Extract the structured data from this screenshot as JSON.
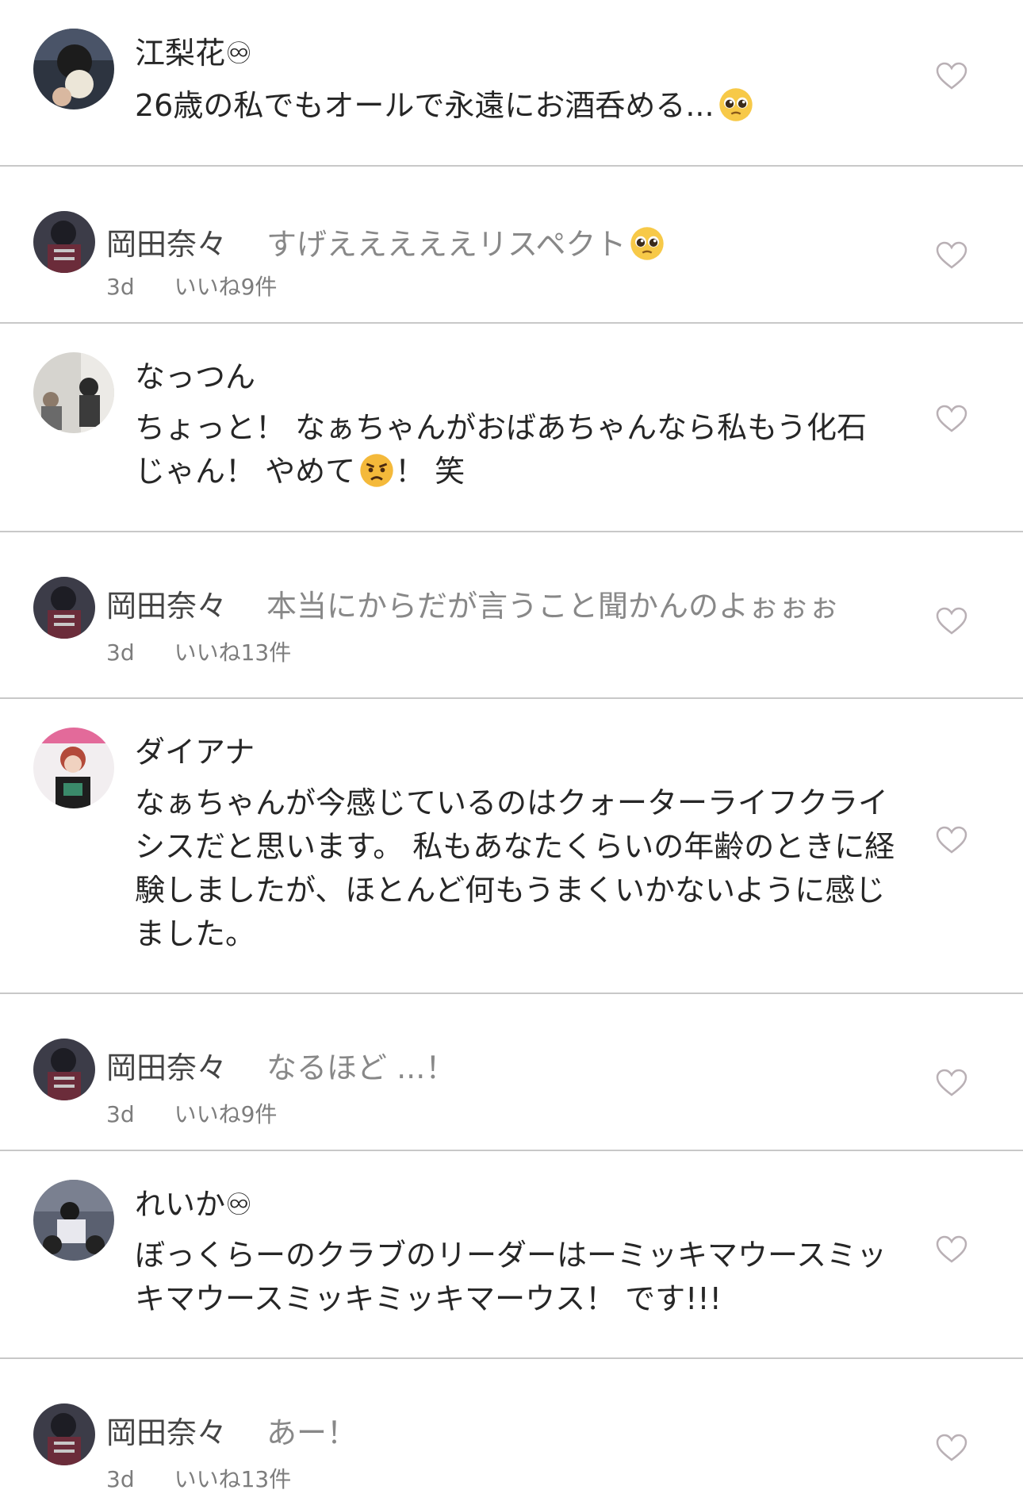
{
  "comments": [
    {
      "type": "comment",
      "author": "江梨花♾",
      "text": "26歳の私でもオールで永遠にお酒呑める...",
      "emoji": "pleading-face-emoji"
    },
    {
      "type": "reply",
      "author": "岡田奈々",
      "text": "すげえええええリスペクト",
      "emoji": "pleading-face-emoji",
      "time": "3d",
      "likes": "いいね9件"
    },
    {
      "type": "comment",
      "author": "なっつん",
      "text_before": "ちょっと！ なぁちゃんがおばあちゃんなら私もう化石じゃん！ やめて",
      "emoji": "angry-face-emoji",
      "text_after": "！ 笑"
    },
    {
      "type": "reply",
      "author": "岡田奈々",
      "text": "本当にからだが言うこと聞かんのよぉぉぉ",
      "time": "3d",
      "likes": "いいね13件"
    },
    {
      "type": "comment",
      "author": "ダイアナ",
      "text": "なぁちゃんが今感じているのはクォーターライフクライシスだと思います。 私もあなたくらいの年齢のときに経験しましたが、ほとんど何もうまくいかないように感じました。"
    },
    {
      "type": "reply",
      "author": "岡田奈々",
      "text": "なるほど ...！",
      "time": "3d",
      "likes": "いいね9件"
    },
    {
      "type": "comment",
      "author": "れいか♾",
      "text": "ぼっくらーのクラブのリーダーはーミッキマウースミッキマウースミッキミッキマーウス！ です!!!"
    },
    {
      "type": "reply",
      "author": "岡田奈々",
      "text": "あー！",
      "time": "3d",
      "likes": "いいね13件"
    }
  ],
  "icons": {
    "like": "heart-outline-icon"
  },
  "colors": {
    "divider": "#c8c8c8",
    "meta": "#7d7d7d",
    "reply_text": "#888888",
    "heart": "#b9b0b5"
  }
}
